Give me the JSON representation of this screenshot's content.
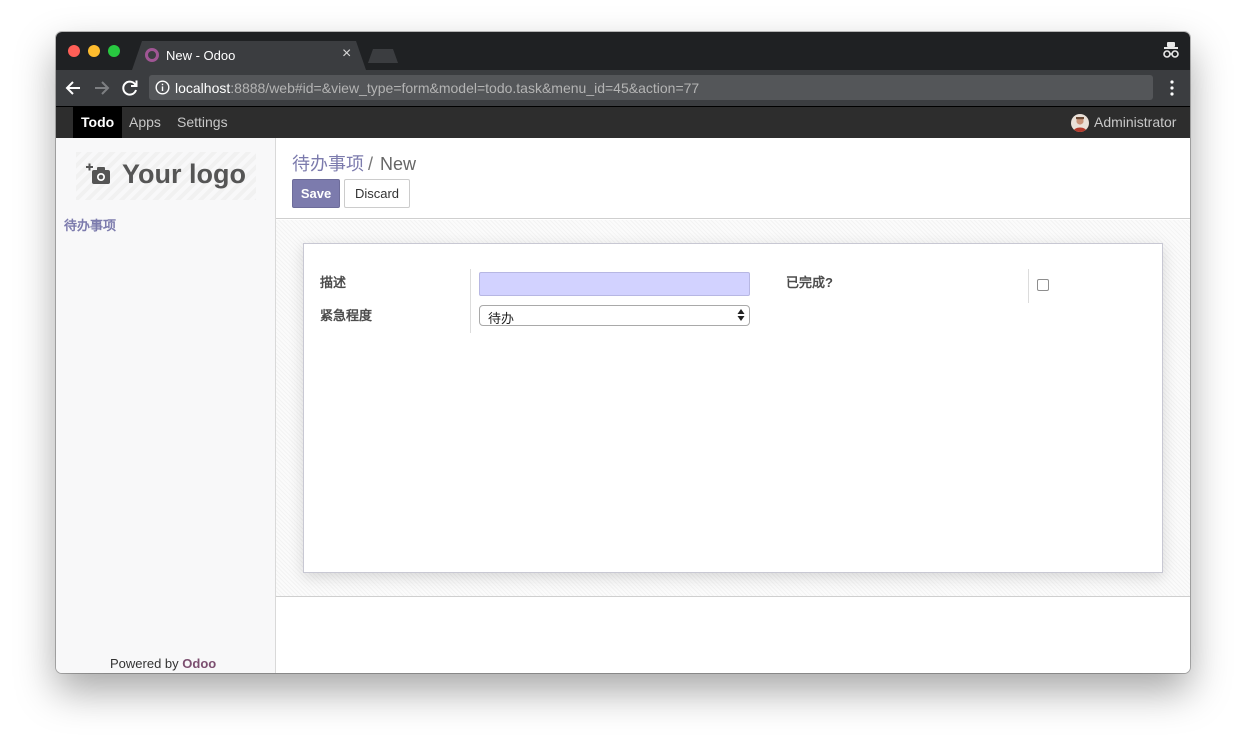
{
  "browser": {
    "tab_title": "New - Odoo",
    "tab_close": "×",
    "url_host": "localhost",
    "url_rest": ":8888/web#id=&view_type=form&model=todo.task&menu_id=45&action=77"
  },
  "odoo_nav": {
    "items": [
      "Todo",
      "Apps",
      "Settings"
    ],
    "active_item": "Todo",
    "user_name": "Administrator"
  },
  "sidebar": {
    "logo_text": "Your logo",
    "menu_item": "待办事项",
    "powered_by": "Powered by",
    "powered_brand": "Odoo"
  },
  "breadcrumb": {
    "parent": "待办事项",
    "separator": "/",
    "current": "New"
  },
  "buttons": {
    "save": "Save",
    "discard": "Discard"
  },
  "form": {
    "description_label": "描述",
    "description_value": "",
    "urgency_label": "紧急程度",
    "urgency_value": "待办",
    "done_label": "已完成?",
    "done_checked": false
  },
  "colors": {
    "accent": "#7c7bad",
    "brand": "#7c4f70",
    "required_field_bg": "#d2d2ff"
  },
  "icons": [
    "back-arrow-icon",
    "forward-arrow-icon",
    "reload-icon",
    "info-icon",
    "menu-kebab-icon",
    "incognito-icon",
    "camera-add-icon",
    "select-arrows-icon"
  ]
}
